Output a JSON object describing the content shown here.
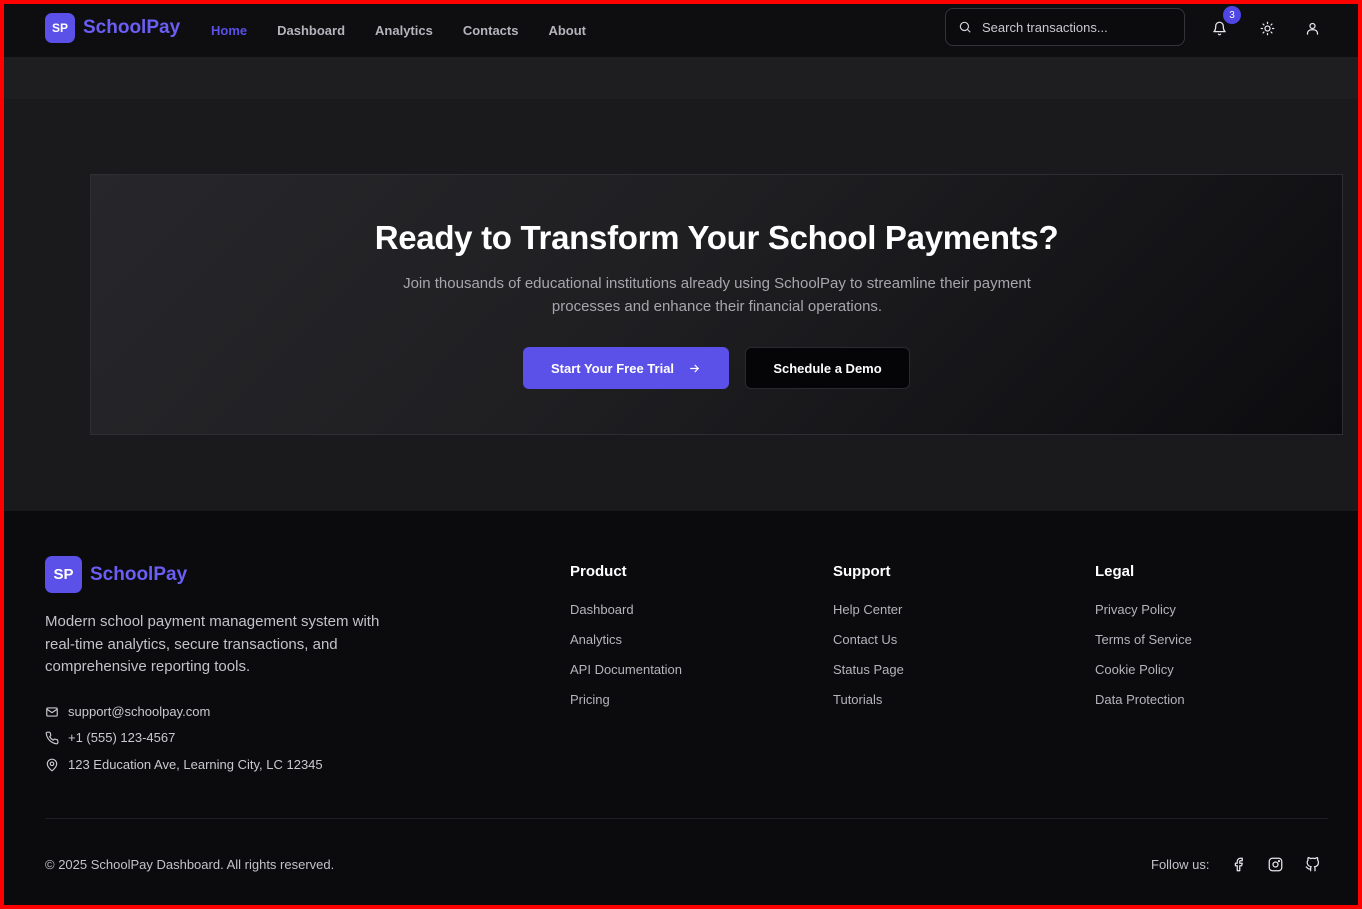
{
  "brand": {
    "badge": "SP",
    "name": "SchoolPay"
  },
  "nav": {
    "links": [
      "Home",
      "Dashboard",
      "Analytics",
      "Contacts",
      "About"
    ],
    "active": "Home"
  },
  "search": {
    "placeholder": "Search transactions..."
  },
  "notifications": {
    "count": "3"
  },
  "header_icons": [
    "bell-icon",
    "sun-icon",
    "user-icon"
  ],
  "cta": {
    "title": "Ready to Transform Your School Payments?",
    "subtitle": "Join thousands of educational institutions already using SchoolPay to streamline their payment processes and enhance their financial operations.",
    "primary_button": "Start Your Free Trial",
    "secondary_button": "Schedule a Demo"
  },
  "footer": {
    "description": "Modern school payment management system with real-time analytics, secure transactions, and comprehensive reporting tools.",
    "contacts": {
      "email": "support@schoolpay.com",
      "phone": "+1 (555) 123-4567",
      "address": "123 Education Ave, Learning City, LC 12345"
    },
    "columns": [
      {
        "title": "Product",
        "links": [
          "Dashboard",
          "Analytics",
          "API Documentation",
          "Pricing"
        ]
      },
      {
        "title": "Support",
        "links": [
          "Help Center",
          "Contact Us",
          "Status Page",
          "Tutorials"
        ]
      },
      {
        "title": "Legal",
        "links": [
          "Privacy Policy",
          "Terms of Service",
          "Cookie Policy",
          "Data Protection"
        ]
      }
    ],
    "copyright": "© 2025 SchoolPay Dashboard. All rights reserved.",
    "follow_label": "Follow us:",
    "social": [
      "facebook-icon",
      "instagram-icon",
      "github-icon"
    ]
  },
  "colors": {
    "accent": "#5b50e8",
    "background": "#1a1a1d",
    "footer": "#0b0b0e",
    "frame_border": "#ff0000"
  }
}
